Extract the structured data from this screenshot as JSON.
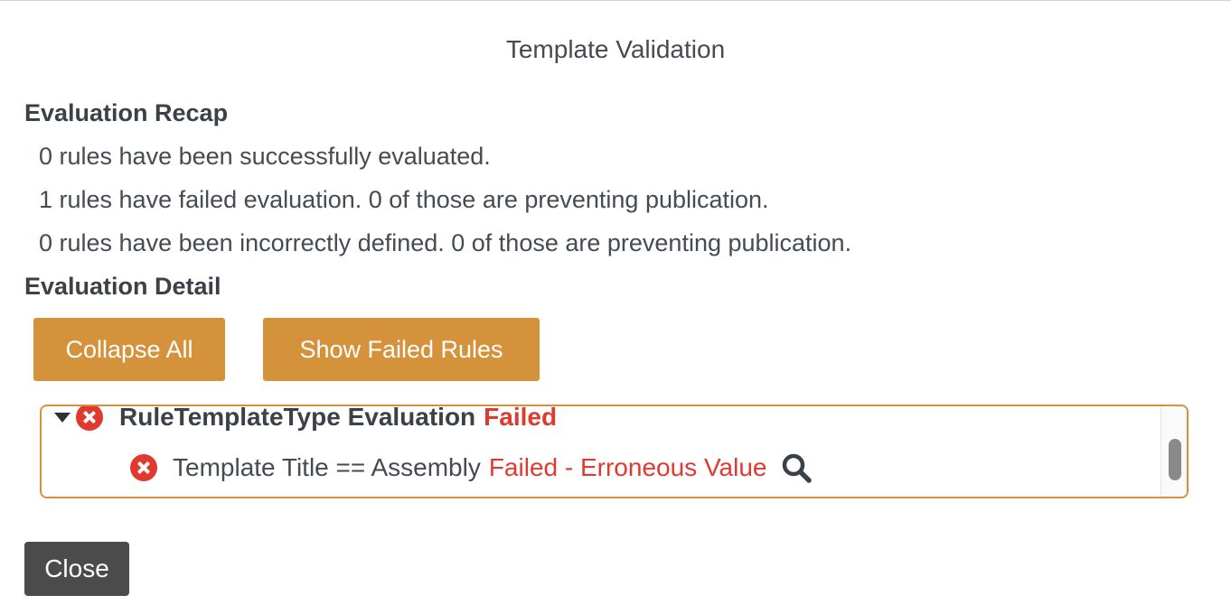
{
  "dialog": {
    "title": "Template Validation"
  },
  "recap": {
    "heading": "Evaluation Recap",
    "lines": [
      "0 rules have been successfully evaluated.",
      "1 rules have failed evaluation. 0 of those are preventing publication.",
      "0 rules have been incorrectly defined. 0 of those are preventing publication."
    ]
  },
  "detail": {
    "heading": "Evaluation Detail",
    "buttons": {
      "collapse_all": "Collapse All",
      "show_failed": "Show Failed Rules"
    },
    "rule": {
      "name": "RuleTemplateType Evaluation",
      "status": "Failed",
      "children": [
        {
          "label": "Template Title == Assembly",
          "status": "Failed - Erroneous Value"
        }
      ]
    }
  },
  "footer": {
    "close_label": "Close"
  },
  "colors": {
    "accent_orange": "#d4923a",
    "error_red": "#e03a2f",
    "close_button": "#4b4b4b"
  },
  "icons": {
    "expand": "caret-down-icon",
    "error": "error-circle-icon",
    "inspect": "search-icon"
  }
}
